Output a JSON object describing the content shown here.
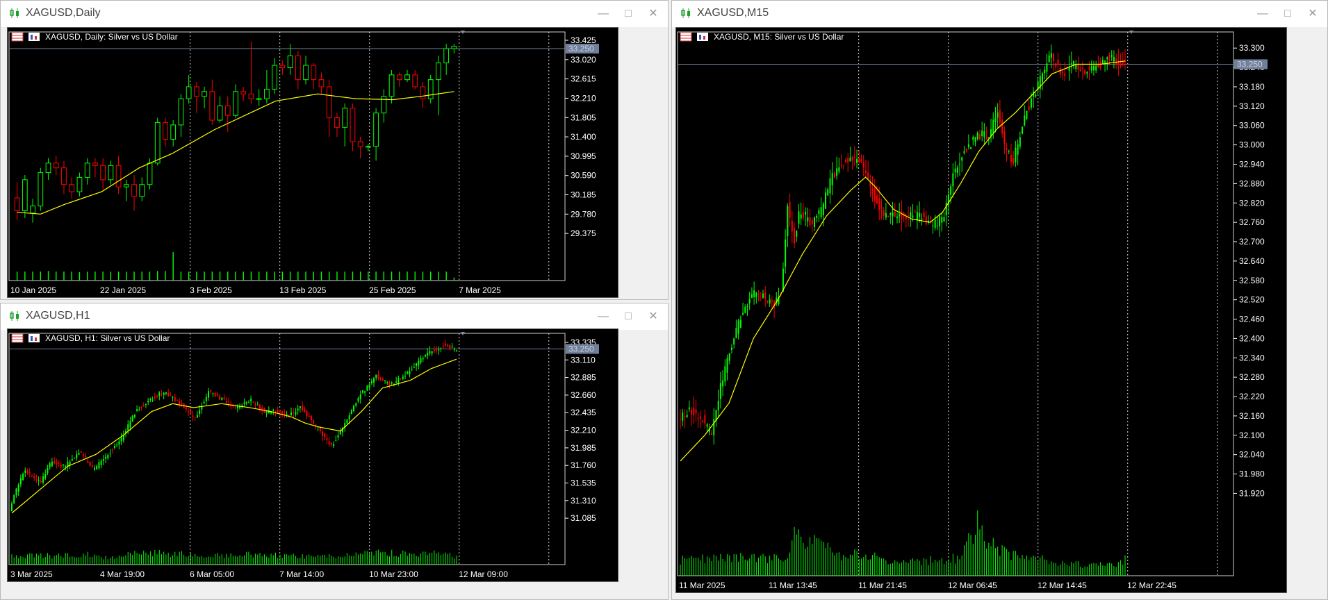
{
  "colors": {
    "bull": "#00ff00",
    "bear": "#ff0000",
    "ma": "#ffff00",
    "volume": "#00ff00",
    "axis_text": "#ffffff",
    "price_line": "#6f7f93",
    "price_tag_bg": "#71809a",
    "chart_bg": "#000000",
    "grid": "#d8d8d8"
  },
  "windows": {
    "daily": {
      "title": "XAGUSD,Daily",
      "info": "XAGUSD, Daily:  Silver vs US Dollar",
      "price_tag": "33.250",
      "buttons": [
        "minimize",
        "maximize",
        "close"
      ]
    },
    "h1": {
      "title": "XAGUSD,H1",
      "info": "XAGUSD, H1:  Silver vs US Dollar",
      "price_tag": "33.250",
      "buttons": [
        "minimize",
        "maximize",
        "close"
      ]
    },
    "m15": {
      "title": "XAGUSD,M15",
      "info": "XAGUSD, M15:  Silver vs US Dollar",
      "price_tag": "33.250",
      "buttons": [
        "minimize",
        "maximize",
        "close"
      ]
    }
  },
  "chart_data": [
    {
      "id": "daily",
      "type": "candlestick",
      "title": "XAGUSD, Daily:  Silver vs US Dollar",
      "ylim": [
        29.1,
        33.6
      ],
      "current_price": 33.25,
      "price_ticks": [
        "33.425",
        "33.020",
        "32.615",
        "32.210",
        "31.805",
        "31.400",
        "30.995",
        "30.590",
        "30.185",
        "29.780",
        "29.375"
      ],
      "time_labels": [
        "10 Jan 2025",
        "22 Jan 2025",
        "3 Feb 2025",
        "13 Feb 2025",
        "25 Feb 2025",
        "7 Mar 2025"
      ],
      "grid": "vertical-dotted",
      "candles": [
        [
          30.12,
          29.85,
          30.45,
          29.65
        ],
        [
          29.85,
          30.5,
          30.6,
          29.7
        ],
        [
          29.8,
          29.95,
          30.1,
          29.6
        ],
        [
          29.95,
          30.65,
          30.75,
          29.85
        ],
        [
          30.65,
          30.85,
          30.95,
          30.5
        ],
        [
          30.85,
          30.75,
          31.0,
          30.6
        ],
        [
          30.75,
          30.4,
          30.9,
          30.2
        ],
        [
          30.4,
          30.25,
          30.55,
          30.1
        ],
        [
          30.25,
          30.55,
          30.65,
          30.15
        ],
        [
          30.55,
          30.85,
          30.95,
          30.4
        ],
        [
          30.85,
          30.8,
          30.95,
          30.55
        ],
        [
          30.8,
          30.5,
          30.95,
          30.3
        ],
        [
          30.5,
          30.8,
          30.9,
          30.4
        ],
        [
          30.8,
          30.35,
          31.0,
          30.2
        ],
        [
          30.35,
          30.4,
          30.5,
          30.05
        ],
        [
          30.4,
          30.15,
          30.6,
          29.85
        ],
        [
          30.15,
          30.4,
          30.55,
          30.05
        ],
        [
          30.4,
          30.85,
          30.95,
          30.3
        ],
        [
          30.85,
          31.7,
          31.8,
          30.8
        ],
        [
          31.7,
          31.35,
          31.8,
          31.2
        ],
        [
          31.35,
          31.65,
          31.75,
          31.2
        ],
        [
          31.65,
          32.2,
          32.3,
          31.4
        ],
        [
          32.2,
          32.45,
          32.7,
          32.1
        ],
        [
          32.45,
          32.25,
          32.55,
          31.9
        ],
        [
          32.25,
          32.35,
          32.45,
          32.0
        ],
        [
          32.35,
          31.75,
          32.6,
          31.65
        ],
        [
          31.75,
          32.05,
          32.25,
          31.7
        ],
        [
          32.05,
          31.85,
          32.25,
          31.5
        ],
        [
          31.85,
          32.35,
          32.5,
          31.8
        ],
        [
          32.35,
          32.3,
          32.45,
          32.15
        ],
        [
          32.3,
          32.2,
          33.4,
          32.1
        ],
        [
          32.2,
          32.2,
          32.4,
          32.05
        ],
        [
          32.2,
          32.4,
          32.8,
          32.1
        ],
        [
          32.4,
          32.9,
          33.05,
          32.3
        ],
        [
          32.9,
          32.85,
          33.0,
          32.7
        ],
        [
          32.85,
          33.1,
          33.35,
          32.7
        ],
        [
          33.1,
          32.6,
          33.2,
          32.4
        ],
        [
          32.6,
          32.9,
          33.1,
          32.5
        ],
        [
          32.9,
          32.6,
          32.95,
          32.4
        ],
        [
          32.6,
          32.45,
          32.75,
          32.3
        ],
        [
          32.45,
          31.8,
          32.6,
          31.4
        ],
        [
          31.8,
          31.6,
          31.9,
          31.4
        ],
        [
          31.6,
          32.0,
          32.1,
          31.2
        ],
        [
          32.0,
          31.3,
          32.1,
          31.1
        ],
        [
          31.3,
          31.2,
          31.4,
          30.95
        ],
        [
          31.2,
          31.2,
          31.25,
          31.1
        ],
        [
          31.2,
          31.9,
          32.0,
          30.9
        ],
        [
          31.9,
          32.25,
          32.4,
          31.7
        ],
        [
          32.25,
          32.7,
          32.8,
          32.1
        ],
        [
          32.7,
          32.6,
          32.75,
          32.45
        ],
        [
          32.6,
          32.7,
          32.8,
          32.55
        ],
        [
          32.7,
          32.45,
          32.8,
          32.4
        ],
        [
          32.45,
          32.2,
          32.55,
          32.0
        ],
        [
          32.2,
          32.6,
          32.7,
          32.1
        ],
        [
          32.6,
          32.95,
          33.1,
          31.85
        ],
        [
          32.95,
          33.25,
          33.35,
          32.7
        ],
        [
          33.25,
          33.3,
          33.35,
          33.15
        ]
      ],
      "ma": [
        [
          0,
          29.82
        ],
        [
          5,
          29.78
        ],
        [
          10,
          29.98
        ],
        [
          18,
          30.25
        ],
        [
          26,
          30.75
        ],
        [
          33,
          31.05
        ],
        [
          42,
          31.55
        ],
        [
          55,
          32.15
        ],
        [
          64,
          32.3
        ],
        [
          72,
          32.2
        ],
        [
          80,
          32.18
        ],
        [
          86,
          32.25
        ],
        [
          93,
          32.35
        ]
      ],
      "volume": [
        0.3,
        0.3,
        0.3,
        0.3,
        0.32,
        0.3,
        0.3,
        0.3,
        0.28,
        0.3,
        0.3,
        0.3,
        0.3,
        0.3,
        0.3,
        0.3,
        0.3,
        0.3,
        0.32,
        0.32,
        0.95,
        0.3,
        0.3,
        0.3,
        0.3,
        0.3,
        0.3,
        0.3,
        0.3,
        0.3,
        0.3,
        0.3,
        0.3,
        0.3,
        0.3,
        0.3,
        0.3,
        0.3,
        0.3,
        0.3,
        0.3,
        0.3,
        0.3,
        0.3,
        0.3,
        0.3,
        0.3,
        0.3,
        0.3,
        0.3,
        0.3,
        0.3,
        0.3,
        0.3,
        0.3,
        0.3,
        0.1
      ]
    },
    {
      "id": "h1",
      "type": "candlestick",
      "title": "XAGUSD, H1:  Silver vs US Dollar",
      "ylim": [
        30.9,
        33.45
      ],
      "current_price": 33.25,
      "price_ticks": [
        "33.335",
        "33.110",
        "32.885",
        "32.660",
        "32.435",
        "32.210",
        "31.985",
        "31.760",
        "31.535",
        "31.310",
        "31.085"
      ],
      "time_labels": [
        "3 Mar 2025",
        "4 Mar 19:00",
        "6 Mar 05:00",
        "7 Mar 14:00",
        "10 Mar 23:00",
        "12 Mar 09:00"
      ],
      "grid": "vertical-dotted",
      "path": [
        [
          0,
          31.2
        ],
        [
          10,
          31.7
        ],
        [
          22,
          31.55
        ],
        [
          30,
          31.8
        ],
        [
          40,
          31.75
        ],
        [
          50,
          31.95
        ],
        [
          60,
          31.7
        ],
        [
          70,
          31.9
        ],
        [
          80,
          32.1
        ],
        [
          90,
          32.45
        ],
        [
          100,
          32.6
        ],
        [
          110,
          32.7
        ],
        [
          122,
          32.55
        ],
        [
          132,
          32.35
        ],
        [
          142,
          32.7
        ],
        [
          152,
          32.6
        ],
        [
          162,
          32.5
        ],
        [
          172,
          32.6
        ],
        [
          182,
          32.45
        ],
        [
          192,
          32.45
        ],
        [
          200,
          32.4
        ],
        [
          208,
          32.5
        ],
        [
          215,
          32.35
        ],
        [
          222,
          32.2
        ],
        [
          230,
          32.0
        ],
        [
          240,
          32.3
        ],
        [
          250,
          32.65
        ],
        [
          262,
          32.9
        ],
        [
          272,
          32.8
        ],
        [
          282,
          32.9
        ],
        [
          290,
          33.05
        ],
        [
          300,
          33.2
        ],
        [
          311,
          33.3
        ],
        [
          318,
          33.25
        ]
      ],
      "ma": [
        [
          0,
          31.15
        ],
        [
          20,
          31.45
        ],
        [
          40,
          31.75
        ],
        [
          60,
          31.9
        ],
        [
          80,
          32.15
        ],
        [
          100,
          32.45
        ],
        [
          115,
          32.55
        ],
        [
          130,
          32.5
        ],
        [
          150,
          32.55
        ],
        [
          170,
          32.5
        ],
        [
          185,
          32.45
        ],
        [
          200,
          32.38
        ],
        [
          210,
          32.3
        ],
        [
          220,
          32.25
        ],
        [
          235,
          32.2
        ],
        [
          250,
          32.45
        ],
        [
          265,
          32.75
        ],
        [
          285,
          32.85
        ],
        [
          300,
          33.0
        ],
        [
          318,
          33.12
        ]
      ],
      "volume_profile": [
        [
          0,
          0.4
        ],
        [
          40,
          0.4
        ],
        [
          55,
          0.45
        ],
        [
          70,
          0.3
        ],
        [
          90,
          0.55
        ],
        [
          110,
          0.5
        ],
        [
          140,
          0.4
        ],
        [
          175,
          0.45
        ],
        [
          205,
          0.4
        ],
        [
          230,
          0.35
        ],
        [
          260,
          0.55
        ],
        [
          290,
          0.45
        ],
        [
          305,
          0.55
        ],
        [
          318,
          0.35
        ]
      ]
    },
    {
      "id": "m15",
      "type": "candlestick",
      "title": "XAGUSD, M15:  Silver vs US Dollar",
      "ylim": [
        31.88,
        33.35
      ],
      "current_price": 33.25,
      "price_ticks": [
        "33.300",
        "33.240",
        "33.180",
        "33.120",
        "33.060",
        "33.000",
        "32.940",
        "32.880",
        "32.820",
        "32.760",
        "32.700",
        "32.640",
        "32.580",
        "32.520",
        "32.460",
        "32.400",
        "32.340",
        "32.280",
        "32.220",
        "32.160",
        "32.100",
        "32.040",
        "31.980",
        "31.920"
      ],
      "time_labels": [
        "11 Mar 2025",
        "11 Mar 13:45",
        "11 Mar 21:45",
        "12 Mar 06:45",
        "12 Mar 14:45",
        "12 Mar 22:45"
      ],
      "grid": "vertical-dotted",
      "path": [
        [
          0,
          32.15
        ],
        [
          10,
          32.18
        ],
        [
          20,
          32.15
        ],
        [
          27,
          32.1
        ],
        [
          35,
          32.25
        ],
        [
          45,
          32.4
        ],
        [
          55,
          32.5
        ],
        [
          65,
          32.55
        ],
        [
          78,
          32.5
        ],
        [
          85,
          32.55
        ],
        [
          90,
          32.82
        ],
        [
          95,
          32.7
        ],
        [
          100,
          32.8
        ],
        [
          110,
          32.75
        ],
        [
          118,
          32.8
        ],
        [
          126,
          32.9
        ],
        [
          140,
          32.96
        ],
        [
          150,
          32.95
        ],
        [
          160,
          32.85
        ],
        [
          168,
          32.78
        ],
        [
          178,
          32.78
        ],
        [
          190,
          32.78
        ],
        [
          200,
          32.78
        ],
        [
          210,
          32.75
        ],
        [
          218,
          32.78
        ],
        [
          225,
          32.9
        ],
        [
          235,
          32.98
        ],
        [
          245,
          33.03
        ],
        [
          255,
          33.03
        ],
        [
          262,
          33.1
        ],
        [
          268,
          33.0
        ],
        [
          275,
          32.95
        ],
        [
          285,
          33.1
        ],
        [
          295,
          33.18
        ],
        [
          305,
          33.28
        ],
        [
          315,
          33.22
        ],
        [
          325,
          33.25
        ],
        [
          335,
          33.23
        ],
        [
          345,
          33.25
        ],
        [
          355,
          33.27
        ],
        [
          365,
          33.25
        ]
      ],
      "ma": [
        [
          0,
          32.02
        ],
        [
          20,
          32.1
        ],
        [
          40,
          32.2
        ],
        [
          60,
          32.4
        ],
        [
          80,
          32.52
        ],
        [
          100,
          32.66
        ],
        [
          120,
          32.78
        ],
        [
          140,
          32.86
        ],
        [
          152,
          32.9
        ],
        [
          160,
          32.87
        ],
        [
          175,
          32.8
        ],
        [
          190,
          32.77
        ],
        [
          205,
          32.76
        ],
        [
          215,
          32.79
        ],
        [
          230,
          32.88
        ],
        [
          245,
          32.98
        ],
        [
          260,
          33.05
        ],
        [
          275,
          33.1
        ],
        [
          290,
          33.16
        ],
        [
          305,
          33.22
        ],
        [
          325,
          33.25
        ],
        [
          345,
          33.25
        ],
        [
          365,
          33.26
        ]
      ],
      "volume_profile": [
        [
          0,
          0.3
        ],
        [
          60,
          0.35
        ],
        [
          88,
          0.3
        ],
        [
          92,
          0.9
        ],
        [
          110,
          0.6
        ],
        [
          130,
          0.4
        ],
        [
          150,
          0.4
        ],
        [
          175,
          0.25
        ],
        [
          210,
          0.3
        ],
        [
          230,
          0.35
        ],
        [
          243,
          1.0
        ],
        [
          255,
          0.6
        ],
        [
          280,
          0.35
        ],
        [
          300,
          0.3
        ],
        [
          330,
          0.2
        ],
        [
          355,
          0.2
        ],
        [
          365,
          0.3
        ]
      ]
    }
  ]
}
